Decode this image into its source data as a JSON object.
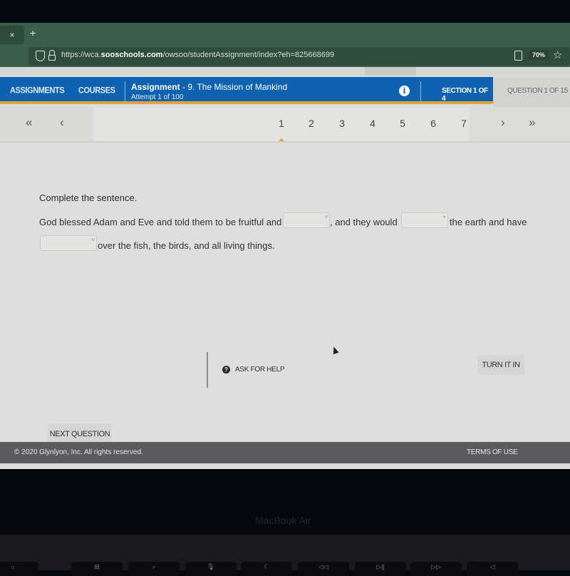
{
  "browser": {
    "tab_close": "×",
    "new_tab": "+",
    "url_prefix": "https://wca.",
    "url_domain": "sooschools.com",
    "url_path": "/owsoo/studentAssignment/index?eh=825668699",
    "zoom_level": "70%",
    "star": "☆"
  },
  "nav": {
    "assignments": "ASSIGNMENTS",
    "courses": "COURSES",
    "assignment_label": "Assignment",
    "assignment_name": " - 9. The Mission of Mankind",
    "attempt": "Attempt 1 of 100",
    "info": "i",
    "section": "SECTION 1 OF 4",
    "question": "QUESTION 1 OF 15"
  },
  "pager": {
    "first": "«",
    "prev": "‹",
    "next": "›",
    "last": "»",
    "pages": [
      "1",
      "2",
      "3",
      "4",
      "5",
      "6",
      "7"
    ],
    "current_page": "1"
  },
  "question": {
    "prompt": "Complete the sentence.",
    "part1": "God blessed Adam and Eve and told them to be fruitful and",
    "part2": ", and they would",
    "part3": "the earth and have",
    "part4": "over the fish, the birds, and all living things.",
    "blanks": [
      {
        "value": "",
        "caret": "˅"
      },
      {
        "value": "",
        "caret": "˅"
      },
      {
        "value": "",
        "caret": "˅"
      }
    ]
  },
  "actions": {
    "next_question": "NEXT QUESTION",
    "ask_for_help": "ASK FOR HELP",
    "help_icon": "?",
    "turn_it_in": "TURN IT IN"
  },
  "footer": {
    "copyright": "© 2020 Glynlyon, Inc. All rights reserved.",
    "terms": "TERMS OF USE"
  },
  "device": {
    "label": "MacBook Air",
    "keys": [
      "☼",
      "⊞",
      "⌕",
      "🎙",
      "☾",
      "◁◁",
      "▷||",
      "▷▷",
      "◁"
    ]
  }
}
